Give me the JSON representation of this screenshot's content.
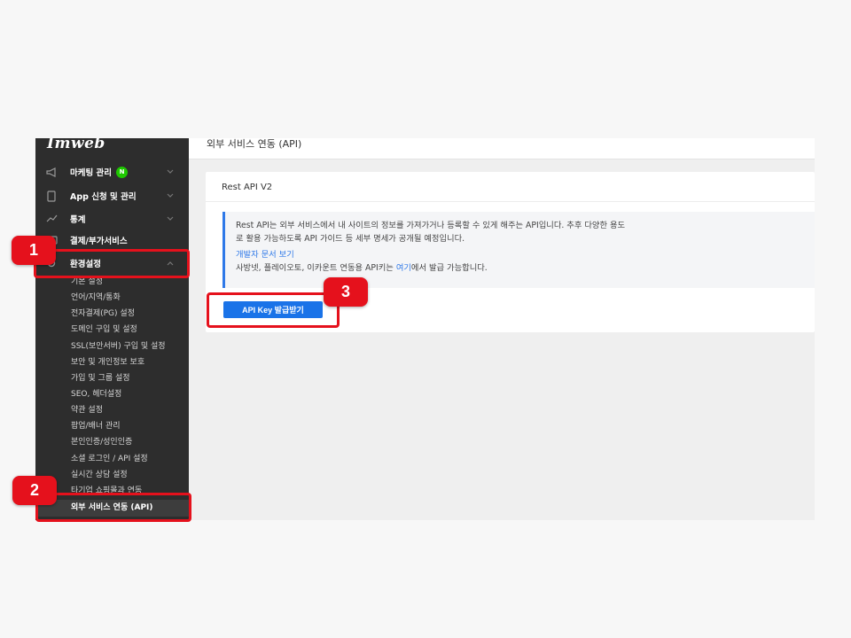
{
  "app": {
    "logo": "Imweb"
  },
  "sidebar": {
    "items": [
      {
        "label": "마케팅 관리",
        "badge": "N",
        "icon": "megaphone-icon"
      },
      {
        "label": "App 신청 및 관리",
        "icon": "mobile-icon"
      },
      {
        "label": "통계",
        "icon": "chart-icon"
      },
      {
        "label": "결제/부가서비스",
        "icon": "card-icon"
      },
      {
        "label": "환경설정",
        "icon": "gear-icon",
        "expanded": true
      }
    ],
    "submenu": [
      "기본 설정",
      "언어/지역/통화",
      "전자결제(PG) 설정",
      "도메인 구입 및 설정",
      "SSL(보안서버) 구입 및 설정",
      "보안 및 개인정보 보호",
      "가입 및 그룹 설정",
      "SEO, 헤더설정",
      "약관 설정",
      "팝업/배너 관리",
      "본인인증/성인인증",
      "소셜 로그인 / API 설정",
      "실시간 상담 설정",
      "타기업 쇼핑몰과 연동",
      "외부 서비스 연동 (API)"
    ],
    "active_submenu": "외부 서비스 연동 (API)"
  },
  "main": {
    "page_title": "외부 서비스 연동 (API)",
    "card_title": "Rest API V2",
    "info": {
      "line1": "Rest API는 외부 서비스에서 내 사이트의 정보를 가져가거나 등록할 수 있게 해주는 API입니다. 추후 다양한 용도",
      "line2": "로 활용 가능하도록 API 가이드 등 세부 명세가 공개될 예정입니다.",
      "doc_link": "개발자 문서 보기",
      "line3_prefix": "사방넷, 플레이오토, 이카운트 연동용 API키는 ",
      "line3_link": "여기",
      "line3_suffix": "에서 발급 가능합니다."
    },
    "button_label": "API Key 발급받기"
  },
  "callouts": [
    "1",
    "2",
    "3"
  ],
  "colors": {
    "accent": "#1a73e8",
    "callout": "#e5111c",
    "sidebar_bg": "#2d2d2d",
    "badge": "#1ec800"
  }
}
